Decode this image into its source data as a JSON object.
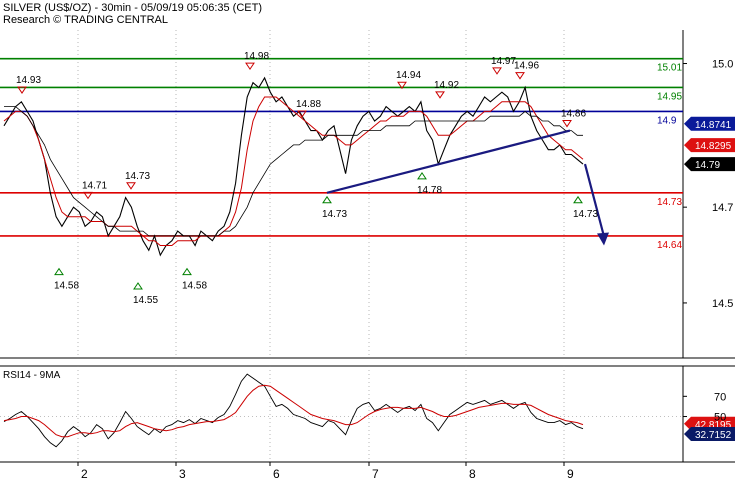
{
  "header": {
    "title": "SILVER (US$/OZ) - 30min - 05/09/19 05:06:35 (CET)",
    "research": "Research © TRADING CENTRAL"
  },
  "colors": {
    "price": "#000000",
    "ma_fast": "#cc0000",
    "ma_slow": "#000000",
    "support_resistance": "#dd0000",
    "green_levels": "#008000",
    "pivot": "#000099",
    "trend": "#1a1a80",
    "arrow": "#1a1a80",
    "rsi_ma": "#cc0000",
    "tag_red": "#dd1111",
    "tag_black": "#000000",
    "tag_blue": "#0a1a99",
    "tag_navy": "#0a1a66"
  },
  "chart_data": [
    {
      "type": "line",
      "panel": "price",
      "y_ticks": [
        15.0,
        14.7,
        14.5
      ],
      "y_tick_labels": [
        "15.0",
        "14.7",
        "14.5"
      ],
      "ylim": [
        14.385,
        15.07
      ],
      "x_ticks": [
        "2",
        "3",
        "6",
        "7",
        "8",
        "9"
      ],
      "grid": "vertical dotted",
      "levels": [
        {
          "value": 15.01,
          "label": "15.01",
          "color": "green"
        },
        {
          "value": 14.95,
          "label": "14.95",
          "color": "green"
        },
        {
          "value": 14.9,
          "label": "14.9",
          "color": "blue"
        },
        {
          "value": 14.73,
          "label": "14.73",
          "color": "red"
        },
        {
          "value": 14.64,
          "label": "14.64",
          "color": "red"
        }
      ],
      "price_tags": [
        {
          "label": "14.8741",
          "value": 14.8741,
          "style": "blue"
        },
        {
          "label": "14.8295",
          "value": 14.8295,
          "style": "red"
        },
        {
          "label": "14.79",
          "value": 14.79,
          "style": "black"
        }
      ],
      "peak_labels": [
        {
          "label": "14.93",
          "dir": "high"
        },
        {
          "label": "14.71",
          "dir": "high"
        },
        {
          "label": "14.73",
          "dir": "high"
        },
        {
          "label": "14.98",
          "dir": "high"
        },
        {
          "label": "14.88",
          "dir": "high"
        },
        {
          "label": "14.94",
          "dir": "high"
        },
        {
          "label": "14.92",
          "dir": "high"
        },
        {
          "label": "14.97",
          "dir": "high"
        },
        {
          "label": "14.96",
          "dir": "high"
        },
        {
          "label": "14.86",
          "dir": "high"
        },
        {
          "label": "14.58",
          "dir": "low"
        },
        {
          "label": "14.55",
          "dir": "low"
        },
        {
          "label": "14.58",
          "dir": "low"
        },
        {
          "label": "14.73",
          "dir": "low"
        },
        {
          "label": "14.78",
          "dir": "low"
        },
        {
          "label": "14.73",
          "dir": "low"
        }
      ],
      "series": [
        {
          "style": "price",
          "values": [
            14.87,
            14.89,
            14.91,
            14.92,
            14.9,
            14.88,
            14.84,
            14.8,
            14.73,
            14.68,
            14.66,
            14.68,
            14.7,
            14.69,
            14.66,
            14.67,
            14.69,
            14.68,
            14.64,
            14.66,
            14.68,
            14.72,
            14.7,
            14.66,
            14.63,
            14.61,
            14.64,
            14.6,
            14.62,
            14.63,
            14.65,
            14.64,
            14.64,
            14.62,
            14.65,
            14.64,
            14.63,
            14.65,
            14.66,
            14.69,
            14.75,
            14.85,
            14.93,
            14.96,
            14.95,
            14.97,
            14.94,
            14.92,
            14.93,
            14.91,
            14.89,
            14.9,
            14.88,
            14.86,
            14.86,
            14.84,
            14.86,
            14.87,
            14.82,
            14.77,
            14.84,
            14.87,
            14.89,
            14.9,
            14.88,
            14.89,
            14.91,
            14.9,
            14.89,
            14.9,
            14.91,
            14.9,
            14.92,
            14.86,
            14.84,
            14.79,
            14.82,
            14.85,
            14.87,
            14.89,
            14.9,
            14.89,
            14.91,
            14.93,
            14.92,
            14.93,
            14.94,
            14.93,
            14.9,
            14.92,
            14.95,
            14.89,
            14.86,
            14.84,
            14.82,
            14.82,
            14.83,
            14.81,
            14.81,
            14.8,
            14.79
          ]
        },
        {
          "style": "ma_fast",
          "values": [
            14.88,
            14.89,
            14.9,
            14.9,
            14.89,
            14.87,
            14.84,
            14.8,
            14.76,
            14.72,
            14.69,
            14.68,
            14.68,
            14.68,
            14.68,
            14.67,
            14.67,
            14.67,
            14.66,
            14.66,
            14.66,
            14.66,
            14.66,
            14.65,
            14.64,
            14.63,
            14.63,
            14.62,
            14.62,
            14.62,
            14.63,
            14.63,
            14.63,
            14.63,
            14.64,
            14.64,
            14.64,
            14.64,
            14.65,
            14.66,
            14.69,
            14.74,
            14.82,
            14.88,
            14.91,
            14.93,
            14.93,
            14.93,
            14.92,
            14.91,
            14.9,
            14.89,
            14.88,
            14.87,
            14.86,
            14.85,
            14.85,
            14.85,
            14.84,
            14.83,
            14.83,
            14.84,
            14.85,
            14.86,
            14.87,
            14.88,
            14.88,
            14.89,
            14.89,
            14.89,
            14.9,
            14.9,
            14.9,
            14.89,
            14.87,
            14.85,
            14.85,
            14.85,
            14.86,
            14.87,
            14.88,
            14.88,
            14.89,
            14.9,
            14.9,
            14.91,
            14.92,
            14.92,
            14.92,
            14.92,
            14.92,
            14.91,
            14.89,
            14.87,
            14.85,
            14.84,
            14.83,
            14.82,
            14.82,
            14.81,
            14.8
          ]
        },
        {
          "style": "ma_slow",
          "values": [
            14.91,
            14.91,
            14.91,
            14.9,
            14.89,
            14.87,
            14.85,
            14.83,
            14.8,
            14.78,
            14.76,
            14.74,
            14.72,
            14.71,
            14.7,
            14.69,
            14.68,
            14.67,
            14.66,
            14.66,
            14.65,
            14.65,
            14.65,
            14.65,
            14.65,
            14.64,
            14.64,
            14.64,
            14.64,
            14.64,
            14.64,
            14.64,
            14.64,
            14.64,
            14.64,
            14.64,
            14.64,
            14.64,
            14.65,
            14.65,
            14.66,
            14.68,
            14.7,
            14.73,
            14.75,
            14.77,
            14.79,
            14.8,
            14.81,
            14.82,
            14.83,
            14.83,
            14.84,
            14.84,
            14.84,
            14.84,
            14.85,
            14.85,
            14.85,
            14.85,
            14.85,
            14.85,
            14.86,
            14.86,
            14.86,
            14.86,
            14.87,
            14.87,
            14.87,
            14.87,
            14.87,
            14.88,
            14.88,
            14.88,
            14.88,
            14.88,
            14.88,
            14.88,
            14.88,
            14.88,
            14.88,
            14.88,
            14.88,
            14.88,
            14.89,
            14.89,
            14.89,
            14.89,
            14.89,
            14.89,
            14.9,
            14.89,
            14.89,
            14.88,
            14.88,
            14.87,
            14.87,
            14.86,
            14.86,
            14.85,
            14.85
          ]
        }
      ],
      "trend_line": {
        "from": 14.73,
        "to": 14.86
      },
      "projection": {
        "from": 14.79,
        "to": 14.62
      }
    },
    {
      "type": "line",
      "panel": "rsi",
      "title": "RSI14 - 9MA",
      "y_ticks": [
        70,
        50
      ],
      "y_tick_labels": [
        "70",
        "50"
      ],
      "ylim": [
        5,
        100
      ],
      "hlines": [
        50
      ],
      "value_tags": [
        {
          "label": "42.8195",
          "value": 42.8195,
          "style": "red"
        },
        {
          "label": "32.7152",
          "value": 32.7152,
          "style": "navy"
        }
      ],
      "series": [
        {
          "style": "rsi",
          "values": [
            45,
            48,
            52,
            55,
            50,
            44,
            38,
            30,
            24,
            20,
            26,
            35,
            40,
            36,
            30,
            34,
            42,
            38,
            28,
            34,
            44,
            55,
            48,
            40,
            36,
            32,
            38,
            34,
            40,
            42,
            46,
            44,
            47,
            43,
            48,
            46,
            44,
            49,
            52,
            60,
            72,
            85,
            92,
            88,
            84,
            80,
            70,
            60,
            62,
            58,
            52,
            50,
            48,
            44,
            42,
            40,
            46,
            44,
            38,
            32,
            46,
            58,
            62,
            64,
            56,
            58,
            62,
            58,
            54,
            58,
            60,
            56,
            62,
            48,
            44,
            36,
            44,
            52,
            56,
            60,
            64,
            62,
            64,
            66,
            62,
            64,
            66,
            62,
            58,
            62,
            64,
            54,
            48,
            46,
            44,
            44,
            46,
            42,
            44,
            40,
            38
          ]
        },
        {
          "style": "rsi_ma",
          "values": [
            46,
            47,
            48,
            50,
            50,
            48,
            46,
            42,
            37,
            32,
            30,
            30,
            32,
            34,
            34,
            33,
            34,
            36,
            36,
            35,
            36,
            40,
            43,
            44,
            42,
            40,
            38,
            37,
            36,
            37,
            39,
            40,
            42,
            43,
            44,
            45,
            45,
            46,
            47,
            50,
            54,
            62,
            70,
            76,
            80,
            81,
            80,
            76,
            72,
            68,
            64,
            60,
            56,
            52,
            50,
            48,
            47,
            46,
            44,
            42,
            42,
            44,
            48,
            52,
            55,
            57,
            58,
            59,
            59,
            58,
            58,
            58,
            59,
            57,
            55,
            52,
            50,
            50,
            51,
            53,
            55,
            57,
            59,
            60,
            61,
            62,
            63,
            63,
            62,
            62,
            62,
            61,
            58,
            55,
            52,
            50,
            48,
            46,
            45,
            44,
            42
          ]
        }
      ]
    }
  ]
}
